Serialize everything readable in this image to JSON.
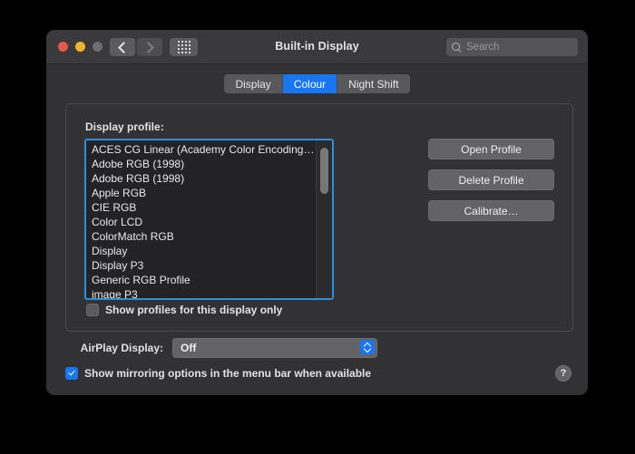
{
  "window": {
    "title": "Built-in Display",
    "traffic_lights": {
      "close": "close-button",
      "minimize": "minimize-button",
      "zoom": "zoom-button"
    },
    "toolbar": {
      "back_icon": "chevron-left-icon",
      "forward_icon": "chevron-right-icon",
      "show_all_icon": "grid-icon"
    },
    "search": {
      "placeholder": "Search",
      "value": "",
      "icon": "search-icon"
    }
  },
  "tabs": [
    {
      "label": "Display",
      "selected": false
    },
    {
      "label": "Colour",
      "selected": true
    },
    {
      "label": "Night Shift",
      "selected": false
    }
  ],
  "panel": {
    "profile_label": "Display profile:",
    "profiles": [
      "ACES CG Linear (Academy Color Encoding…",
      "Adobe RGB (1998)",
      "Adobe RGB (1998)",
      "Apple RGB",
      "CIE RGB",
      "Color LCD",
      "ColorMatch RGB",
      "Display",
      "Display P3",
      "Generic RGB Profile",
      "image P3"
    ],
    "scrollbar": {
      "thumb_position": "top"
    },
    "show_display_only": {
      "label": "Show profiles for this display only",
      "checked": false
    },
    "buttons": [
      {
        "label": "Open Profile"
      },
      {
        "label": "Delete Profile"
      },
      {
        "label": "Calibrate…"
      }
    ]
  },
  "airplay": {
    "label": "AirPlay Display:",
    "value": "Off",
    "options": [
      "Off"
    ]
  },
  "mirroring": {
    "label": "Show mirroring options in the menu bar when available",
    "checked": true
  },
  "help": {
    "label": "?"
  },
  "colors": {
    "accent": "#1876f2",
    "window_bg": "#323234",
    "titlebar_bg": "#3a3a3c",
    "list_bg": "#232325",
    "focus_ring": "#2a8fe0",
    "close": "#e8564a",
    "minimize": "#f2b32c",
    "zoom": "#6e6e70"
  }
}
